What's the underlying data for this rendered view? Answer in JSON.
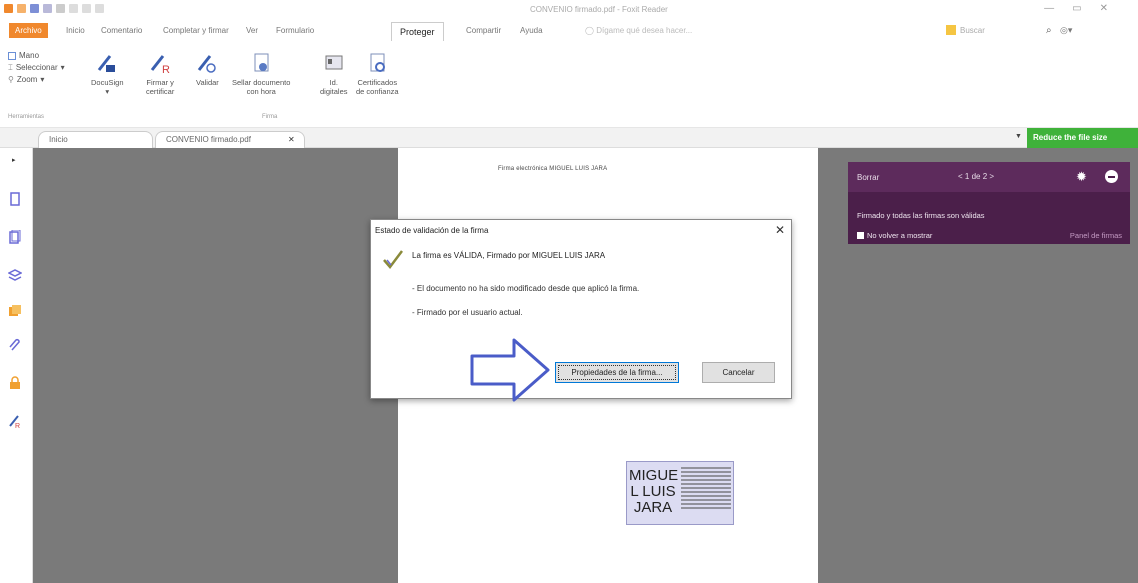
{
  "window": {
    "title": "CONVENIO firmado.pdf - Foxit Reader"
  },
  "ribbon_tabs": [
    {
      "label": "Archivo"
    },
    {
      "label": "Inicio"
    },
    {
      "label": "Comentario"
    },
    {
      "label": "Completar y firmar"
    },
    {
      "label": "Ver"
    },
    {
      "label": "Formulario"
    },
    {
      "label": "Proteger"
    },
    {
      "label": "Compartir"
    },
    {
      "label": "Ayuda"
    }
  ],
  "active_tab": "Proteger",
  "tellme": "Dígame qué desea hacer...",
  "search": {
    "placeholder": "Buscar"
  },
  "tools_group": {
    "items": [
      "Mano",
      "Seleccionar",
      "Zoom"
    ],
    "group_label": "Herramientas"
  },
  "ribbon_buttons": {
    "docusign": "DocuSign",
    "firmar_1": "Firmar y",
    "firmar_2": "certificar",
    "validar": "Validar",
    "sellar_1": "Sellar documento",
    "sellar_2": "con hora",
    "id_1": "Id.",
    "id_2": "digitales",
    "cert_1": "Certificados",
    "cert_2": "de confianza",
    "group_label": "Firma"
  },
  "doc_tabs": [
    {
      "label": "Inicio"
    },
    {
      "label": "CONVENIO firmado.pdf"
    }
  ],
  "reduce_button": "Reduce the file size",
  "page": {
    "header": "Firma electrónica MIGUEL LUIS JARA"
  },
  "stamp": {
    "name_lines": [
      "MIGUE",
      "L LUIS",
      "JARA"
    ]
  },
  "toast": {
    "delete": "Borrar",
    "pager": "< 1 de 2 >",
    "message": "Firmado y todas las firmas son válidas",
    "dont_show": "No volver a mostrar",
    "panel_link": "Panel de firmas"
  },
  "dialog": {
    "title": "Estado de validación de la firma",
    "main": "La firma es VÁLIDA, Firmado por MIGUEL LUIS JARA",
    "line1": "- El documento no ha sido modificado desde que aplicó la firma.",
    "line2": "- Firmado por el usuario actual.",
    "props_button": "Propiedades de la firma...",
    "cancel_button": "Cancelar"
  },
  "colors": {
    "file_tab": "#f0882d",
    "reduce": "#3fb23a",
    "toast": "#4b1f4a",
    "arrow": "#4a5cc8"
  }
}
